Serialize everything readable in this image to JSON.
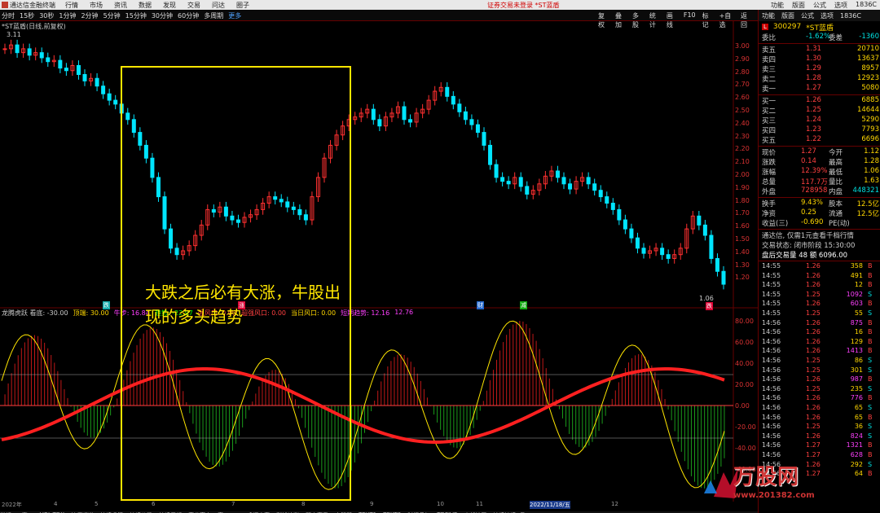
{
  "titlebar": {
    "app": "通达信金融终端",
    "menu": [
      "行情",
      "市场",
      "资讯",
      "数据",
      "发现",
      "交易",
      "问达",
      "圈子"
    ],
    "center": "证券交易未登录 *ST蓝盾",
    "right": [
      "功能",
      "版面",
      "公式",
      "选项",
      "1836C"
    ]
  },
  "toolbar": {
    "periods": [
      "分时",
      "15秒",
      "30秒",
      "1分钟",
      "2分钟",
      "5分钟",
      "15分钟",
      "30分钟",
      "60分钟",
      "多周期"
    ],
    "more": "更多",
    "tools": [
      "复权",
      "叠加",
      "多股",
      "统计",
      "画线",
      "F10",
      "标记",
      "+自选",
      "返回"
    ]
  },
  "chart": {
    "title": "*ST蓝盾(日线,前复权)",
    "high_label": "3.11",
    "low_label": "1.06",
    "y_labels": [
      "3.00",
      "2.90",
      "2.80",
      "2.70",
      "2.60",
      "2.50",
      "2.40",
      "2.30",
      "2.20",
      "2.10",
      "2.00",
      "1.90",
      "1.80",
      "1.70",
      "1.60",
      "1.50",
      "1.40",
      "1.30",
      "1.20"
    ],
    "ind_labels": [
      "80.00",
      "60.00",
      "40.00",
      "20.00",
      "0.00",
      "-20.00",
      "-40.00",
      "-60.00"
    ],
    "markers": [
      "跌",
      "涨",
      "财",
      "减",
      "跌"
    ],
    "indicator_bar": [
      {
        "text": "龙腾虎跃 看底: -30.00",
        "color": "#cccccc"
      },
      {
        "text": "顶端: 30.00",
        "color": "#ffd700"
      },
      {
        "text": "牛步: 16.84",
        "color": "#ff40ff"
      },
      {
        "text": "趋势: -22.97",
        "color": "#00ff00"
      },
      {
        "text": "强风口: 0.00",
        "color": "#ff4040"
      },
      {
        "text": "超强风口: 0.00",
        "color": "#ff4040"
      },
      {
        "text": "当日风口: 0.00",
        "color": "#ffd700"
      },
      {
        "text": "短期趋势: 12.16",
        "color": "#ff40ff"
      },
      {
        "text": "12.76",
        "color": "#ff40ff"
      }
    ],
    "annotation": "大跌之后必有大涨，牛股出现的多头趋势",
    "axis_dates": [
      "2022年",
      "4",
      "5",
      "6",
      "7",
      "8",
      "9",
      "10",
      "11",
      "2022/11/18/五",
      "12"
    ],
    "bottom_tabs": [
      "指标A",
      "窗口",
      "VOL-TDX",
      "抽佣通道",
      "持续吸筹",
      "持续价稳",
      "持续周期",
      "真龙高点",
      "寓MACD",
      "鸡杯庄家",
      "彩排追涨",
      "双十高手",
      "大智慧",
      "TEXT1",
      "TEXT2",
      "时间叠加",
      "TDFIVE",
      "底部核买",
      "持续持续3号"
    ]
  },
  "panel": {
    "tabs": [
      "功能",
      "版面",
      "公式",
      "选项",
      "1836C"
    ],
    "code": "300297",
    "name": "*ST蓝盾",
    "stats_top": [
      {
        "l": "委比",
        "v": "-1.62%",
        "r": "委差",
        "rv": "-1360"
      }
    ],
    "asks": [
      {
        "l": "卖五",
        "p": "1.31",
        "v": "20710"
      },
      {
        "l": "卖四",
        "p": "1.30",
        "v": "13637"
      },
      {
        "l": "卖三",
        "p": "1.29",
        "v": "8957"
      },
      {
        "l": "卖二",
        "p": "1.28",
        "v": "12923"
      },
      {
        "l": "卖一",
        "p": "1.27",
        "v": "5080"
      }
    ],
    "bids": [
      {
        "l": "买一",
        "p": "1.26",
        "v": "6885"
      },
      {
        "l": "买二",
        "p": "1.25",
        "v": "14644"
      },
      {
        "l": "买三",
        "p": "1.24",
        "v": "5290"
      },
      {
        "l": "买四",
        "p": "1.23",
        "v": "7793"
      },
      {
        "l": "买五",
        "p": "1.22",
        "v": "6696"
      }
    ],
    "quote": [
      [
        "现价",
        "1.27",
        "今开",
        "1.12"
      ],
      [
        "涨跌",
        "0.14",
        "最高",
        "1.28"
      ],
      [
        "涨幅",
        "12.39%",
        "最低",
        "1.06"
      ],
      [
        "总量",
        "117.7万",
        "量比",
        "1.63"
      ],
      [
        "外盘",
        "728958",
        "内盘",
        "448321"
      ]
    ],
    "quote2": [
      [
        "换手",
        "9.43%",
        "股本",
        "12.5亿"
      ],
      [
        "净资",
        "0.25",
        "流通",
        "12.5亿"
      ],
      [
        "收益(三)",
        "-0.690",
        "PE(动)",
        ""
      ]
    ],
    "notice1": "通达信, 仅需1元查看千档行情",
    "notice2": "交易状态: 闭市阶段 15:30:00",
    "notice3": "盘后交易量 48 额 6096.00",
    "ticks": [
      [
        "14:55",
        "1.26",
        "358",
        "B"
      ],
      [
        "14:55",
        "1.26",
        "491",
        "B"
      ],
      [
        "14:55",
        "1.26",
        "12",
        "B"
      ],
      [
        "14:55",
        "1.25",
        "1092",
        "S"
      ],
      [
        "14:55",
        "1.26",
        "603",
        "B"
      ],
      [
        "14:55",
        "1.25",
        "55",
        "S"
      ],
      [
        "14:56",
        "1.26",
        "875",
        "B"
      ],
      [
        "14:56",
        "1.26",
        "16",
        "B"
      ],
      [
        "14:56",
        "1.26",
        "129",
        "B"
      ],
      [
        "14:56",
        "1.26",
        "1413",
        "B"
      ],
      [
        "14:56",
        "1.25",
        "86",
        "S"
      ],
      [
        "14:56",
        "1.25",
        "301",
        "S"
      ],
      [
        "14:56",
        "1.26",
        "987",
        "B"
      ],
      [
        "14:56",
        "1.25",
        "235",
        "S"
      ],
      [
        "14:56",
        "1.26",
        "776",
        "B"
      ],
      [
        "14:56",
        "1.26",
        "65",
        "S"
      ],
      [
        "14:56",
        "1.26",
        "65",
        "B"
      ],
      [
        "14:56",
        "1.25",
        "36",
        "S"
      ],
      [
        "14:56",
        "1.26",
        "824",
        "S"
      ],
      [
        "14:56",
        "1.27",
        "1321",
        "B"
      ],
      [
        "14:56",
        "1.27",
        "628",
        "B"
      ],
      [
        "14:56",
        "1.26",
        "292",
        "S"
      ],
      [
        "14:56",
        "1.27",
        "64",
        "B"
      ]
    ],
    "bottom_time": "15:11",
    "bottom_time2": "15:11"
  },
  "watermark": {
    "text": "万股网",
    "url": "www.201382.com"
  }
}
